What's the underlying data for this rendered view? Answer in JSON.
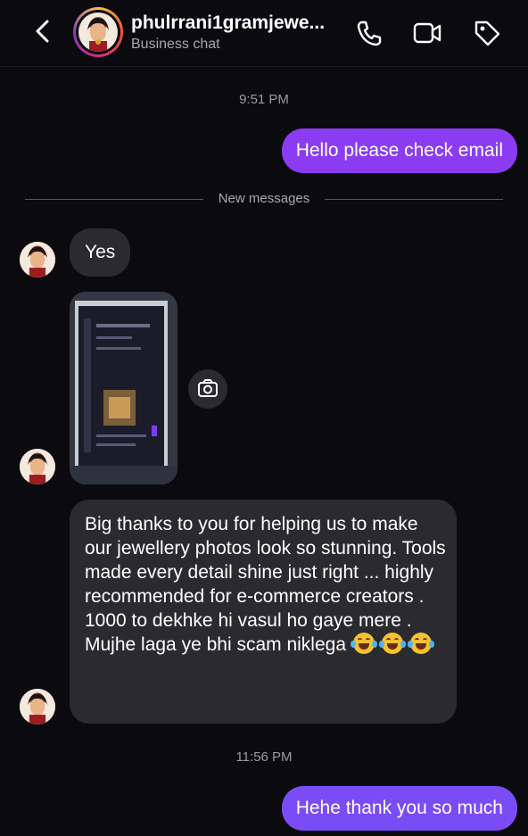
{
  "header": {
    "title": "phulrrani1gramjewe...",
    "subtitle": "Business chat"
  },
  "icons": {
    "back": "chevron-left-icon",
    "call": "phone-icon",
    "video": "video-camera-icon",
    "tag": "tag-icon",
    "camera": "camera-icon"
  },
  "colors": {
    "background": "#0b0b0f",
    "outgoing_bubble": "#8b3cf2",
    "incoming_bubble": "#2a2a2f"
  },
  "messages": {
    "time_1": "9:51 PM",
    "out_1": "Hello please check email",
    "divider": "New messages",
    "in_1": "Yes",
    "in_long_1": "Big thanks to you for helping us to make our jewellery photos look so stunning. Tools made every detail shine just right ... highly recommended for e-commerce creators .",
    "in_long_2": "1000 to dekhke hi vasul ho gaye mere . Mujhe laga ye bhi scam niklega",
    "time_2": "11:56 PM",
    "out_2": "Hehe thank you so much"
  }
}
